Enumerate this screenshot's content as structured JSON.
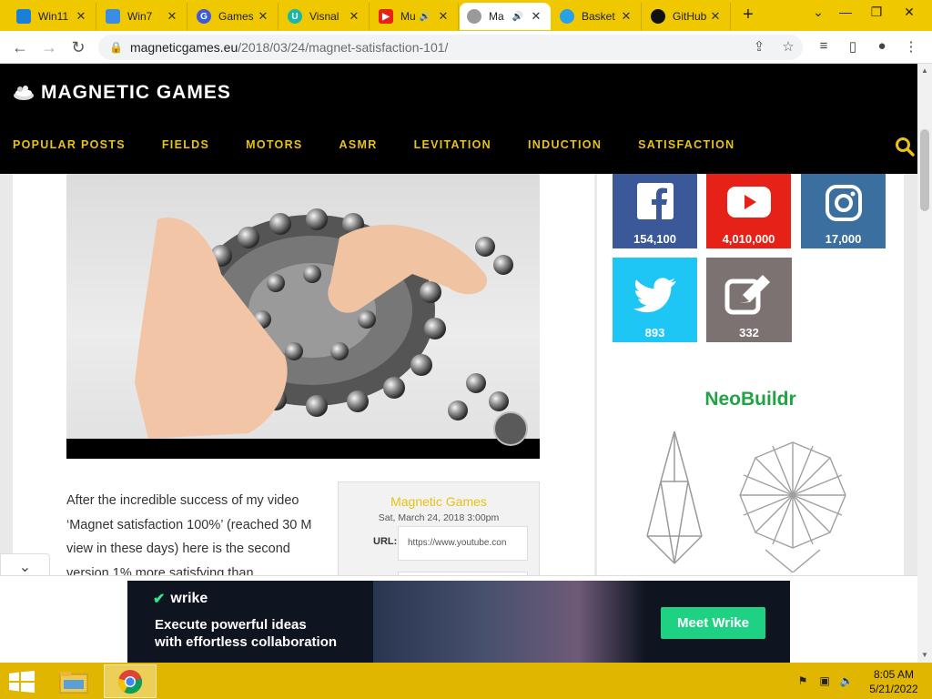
{
  "browser": {
    "tabs": [
      {
        "title": "Win11",
        "favicon_color": "#1a7fd6",
        "active": false
      },
      {
        "title": "Win7",
        "favicon_color": "#3a8de0",
        "active": false
      },
      {
        "title": "Games",
        "favicon_color": "#3b5bdb",
        "active": false
      },
      {
        "title": "Visnal",
        "favicon_color": "#18b8a8",
        "active": false
      },
      {
        "title": "Mu",
        "favicon_color": "#e62117",
        "active": false
      },
      {
        "title": "Ma",
        "favicon_color": "#888888",
        "active": true
      },
      {
        "title": "Basket",
        "favicon_color": "#2aa0e8",
        "active": false
      },
      {
        "title": "GitHub",
        "favicon_color": "#111111",
        "active": false
      }
    ],
    "new_tab_label": "+",
    "url_host": "magneticgames.eu",
    "url_path": "/2018/03/24/magnet-satisfaction-101/"
  },
  "site": {
    "logo_text": "MAGNETIC GAMES",
    "menu": [
      "POPULAR POSTS",
      "FIELDS",
      "MOTORS",
      "ASMR",
      "LEVITATION",
      "INDUCTION",
      "SATISFACTION"
    ],
    "accent_color": "#e8c214"
  },
  "article": {
    "text": "After the incredible success of my video ‘Magnet satisfaction 100%’ (reached 30 M view in these days) here is the second version 1% more satisfying than"
  },
  "embed": {
    "title": "Magnetic Games",
    "date": "Sat, March 24, 2018 3:00pm",
    "url_label": "URL:",
    "url_value": "https://www.youtube.con"
  },
  "social": {
    "facebook": {
      "count": "154,100",
      "color": "#3b5998",
      "icon": "facebook-icon"
    },
    "youtube": {
      "count": "4,010,000",
      "color": "#e62117",
      "icon": "youtube-icon"
    },
    "instagram": {
      "count": "17,000",
      "color": "#3b6fa0",
      "icon": "instagram-icon"
    },
    "twitter": {
      "count": "893",
      "color": "#1dc6f5",
      "icon": "twitter-icon"
    },
    "edit": {
      "count": "332",
      "color": "#7b7271",
      "icon": "edit-icon"
    }
  },
  "sidebar": {
    "neobuildr_title": "NeoBuildr"
  },
  "ad": {
    "brand": "wrike",
    "line1": "Execute powerful ideas",
    "line2": "with effortless collaboration",
    "cta": "Meet Wrike"
  },
  "taskbar": {
    "time": "8:05 AM",
    "date": "5/21/2022"
  }
}
